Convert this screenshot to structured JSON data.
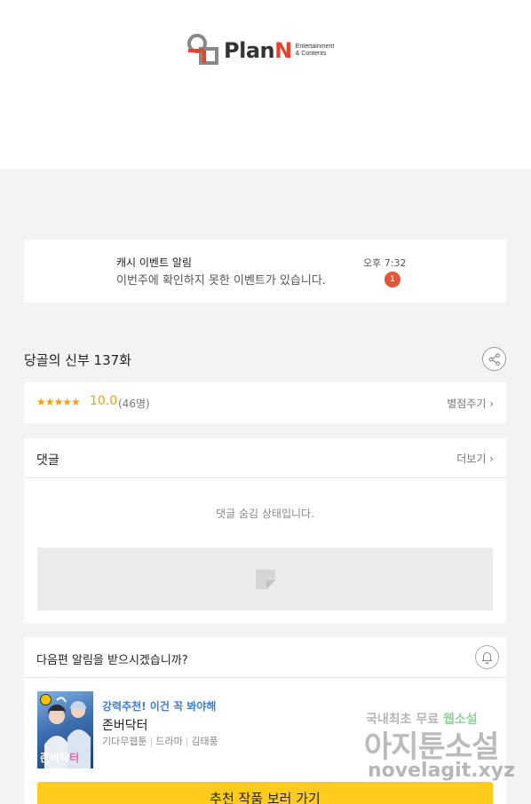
{
  "header": {
    "logo_text": "Plan",
    "logo_text_n": "N",
    "logo_sub_1": "Entertainment",
    "logo_sub_2": "& Contents"
  },
  "notification": {
    "title": "캐시 이벤트 알림",
    "body": "이번주에 확인하지 못한 이벤트가 있습니다.",
    "time": "오후 7:32",
    "badge": "1"
  },
  "episode": {
    "title": "당골의 신부 137화"
  },
  "rating": {
    "stars": "★★★★★",
    "score": "10.0",
    "count": "(46명)",
    "rate_link": "별점주기 ›"
  },
  "comments": {
    "title": "댓글",
    "more": "더보기 ›",
    "hidden_message": "댓글 숨김 상태입니다."
  },
  "recommend": {
    "question": "다음편 알림을 받으시겠습니까?",
    "thumb_title_a": "존버닥",
    "thumb_title_b": "터",
    "tagline": "강력추천! 이건 꼭 봐야해",
    "name": "존버닥터",
    "meta_1": "기다무웹툰",
    "meta_2": "드라마",
    "meta_3": "김태풍",
    "button": "추천 작품 보러 가기"
  },
  "watermark": {
    "line1a": "국내최초 무료 ",
    "line1b": "웹소설",
    "line2": "아지툰소설",
    "line3": "novelagit.xyz"
  },
  "colors": {
    "accent_yellow": "#ffcc1e",
    "star_orange": "#f1a10b",
    "badge_red": "#e0573a",
    "tag_blue": "#3b7de0",
    "logo_red": "#e8412c"
  }
}
